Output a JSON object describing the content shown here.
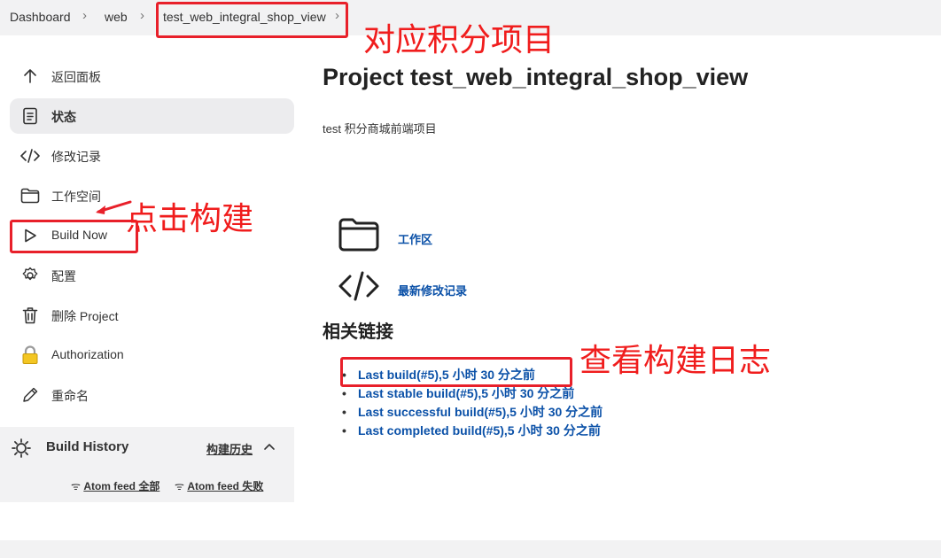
{
  "breadcrumb": {
    "items": [
      "Dashboard",
      "web",
      "test_web_integral_shop_view"
    ],
    "separator": "›"
  },
  "sidebar": {
    "items": [
      {
        "label": "返回面板",
        "icon": "arrow-up-icon"
      },
      {
        "label": "状态",
        "icon": "document-icon",
        "active": true
      },
      {
        "label": "修改记录",
        "icon": "code-icon"
      },
      {
        "label": "工作空间",
        "icon": "folder-icon"
      },
      {
        "label": "Build Now",
        "icon": "play-icon"
      },
      {
        "label": "配置",
        "icon": "gear-icon"
      },
      {
        "label": "删除 Project",
        "icon": "trash-icon"
      },
      {
        "label": "Authorization",
        "icon": "lock-icon"
      },
      {
        "label": "重命名",
        "icon": "pencil-icon"
      }
    ]
  },
  "build_history": {
    "title": "Build History",
    "trend_link": "构建历史",
    "atom_all": "Atom feed 全部",
    "atom_failed": "Atom feed 失败"
  },
  "main": {
    "title": "Project test_web_integral_shop_view",
    "description": "test 积分商城前端项目",
    "workspace_link": "工作区",
    "changes_link": "最新修改记录",
    "related_heading": "相关链接",
    "permalinks": [
      "Last build(#5),5 小时 30 分之前",
      "Last stable build(#5),5 小时 30 分之前",
      "Last successful build(#5),5 小时 30 分之前",
      "Last completed build(#5),5 小时 30 分之前"
    ]
  },
  "annotations": {
    "project_note": "对应积分项目",
    "build_note": "点击构建",
    "log_note": "查看构建日志",
    "color": "#e8202a"
  }
}
